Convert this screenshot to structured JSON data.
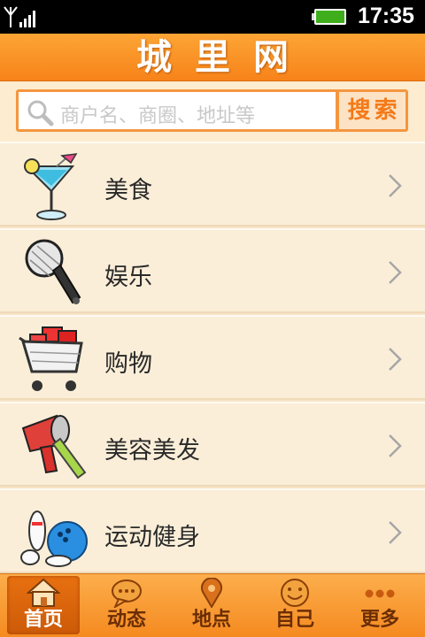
{
  "status_bar": {
    "time": "17:35",
    "battery_color": "#3fae1c"
  },
  "header": {
    "title": "城里网"
  },
  "search": {
    "placeholder": "商户名、商圈、地址等",
    "button_label": "搜索"
  },
  "categories": [
    {
      "label": "美食",
      "icon": "cocktail-icon"
    },
    {
      "label": "娱乐",
      "icon": "microphone-icon"
    },
    {
      "label": "购物",
      "icon": "shopping-cart-icon"
    },
    {
      "label": "美容美发",
      "icon": "hair-dryer-icon"
    },
    {
      "label": "运动健身",
      "icon": "bowling-icon"
    }
  ],
  "bottom_nav": {
    "active": "首页",
    "tabs": [
      {
        "label": "首页",
        "icon": "home-icon"
      },
      {
        "label": "动态",
        "icon": "chat-bubble-icon"
      },
      {
        "label": "地点",
        "icon": "map-pin-icon"
      },
      {
        "label": "自己",
        "icon": "smiley-icon"
      },
      {
        "label": "更多",
        "icon": "more-dots-icon"
      }
    ]
  },
  "colors": {
    "accent": "#f7831a",
    "list_bg": "#fbeed8",
    "nav_active": "#cc5a08"
  }
}
